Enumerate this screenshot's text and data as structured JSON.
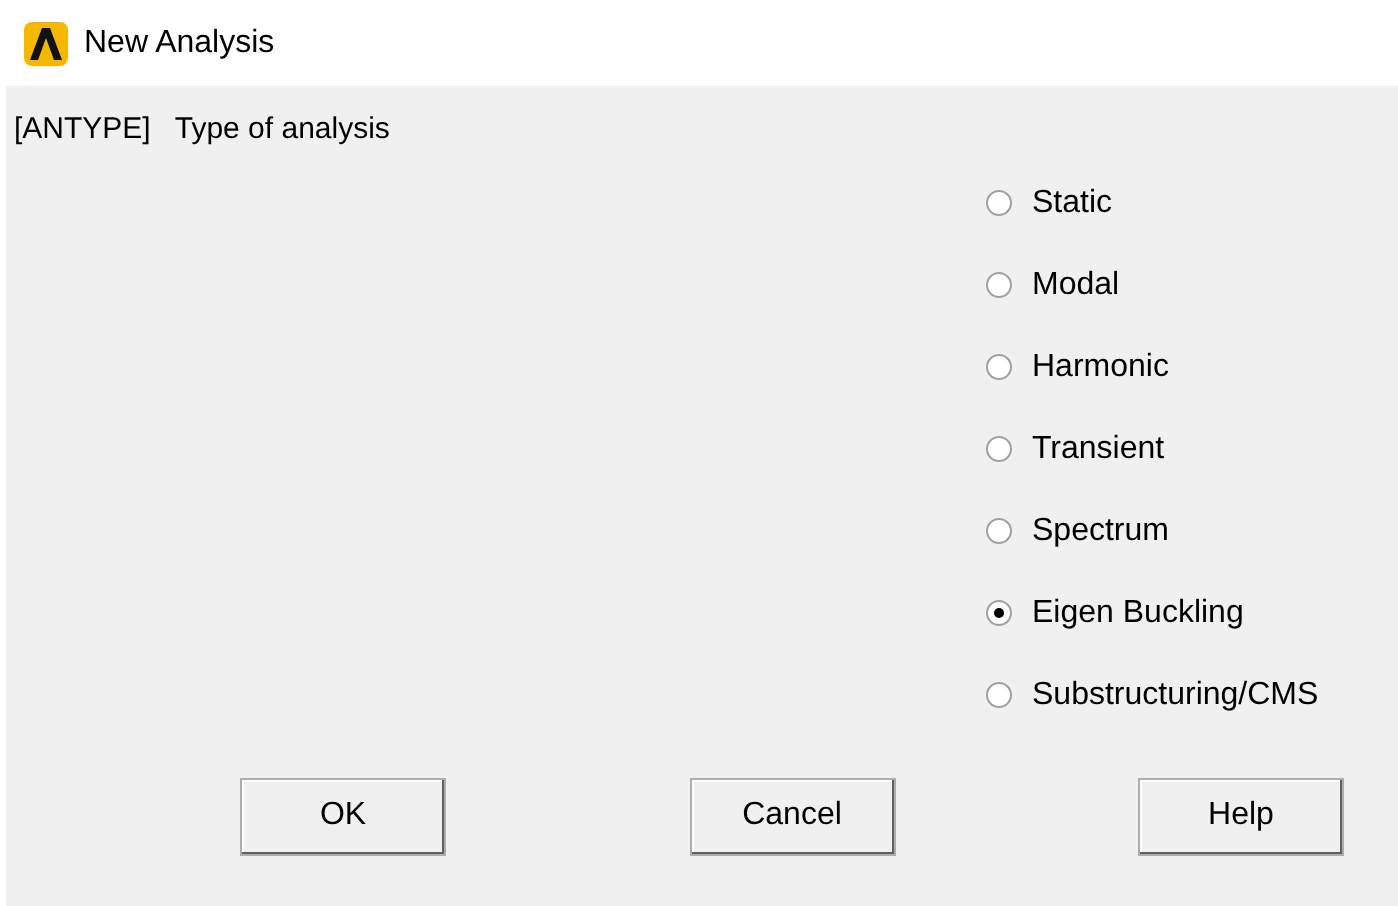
{
  "window": {
    "title": "New Analysis"
  },
  "prompt": {
    "command": "[ANTYPE]",
    "label": "Type of analysis"
  },
  "options": [
    {
      "label": "Static",
      "selected": false
    },
    {
      "label": "Modal",
      "selected": false
    },
    {
      "label": "Harmonic",
      "selected": false
    },
    {
      "label": "Transient",
      "selected": false
    },
    {
      "label": "Spectrum",
      "selected": false
    },
    {
      "label": "Eigen Buckling",
      "selected": true
    },
    {
      "label": "Substructuring/CMS",
      "selected": false
    }
  ],
  "buttons": [
    "OK",
    "Cancel",
    "Help"
  ]
}
